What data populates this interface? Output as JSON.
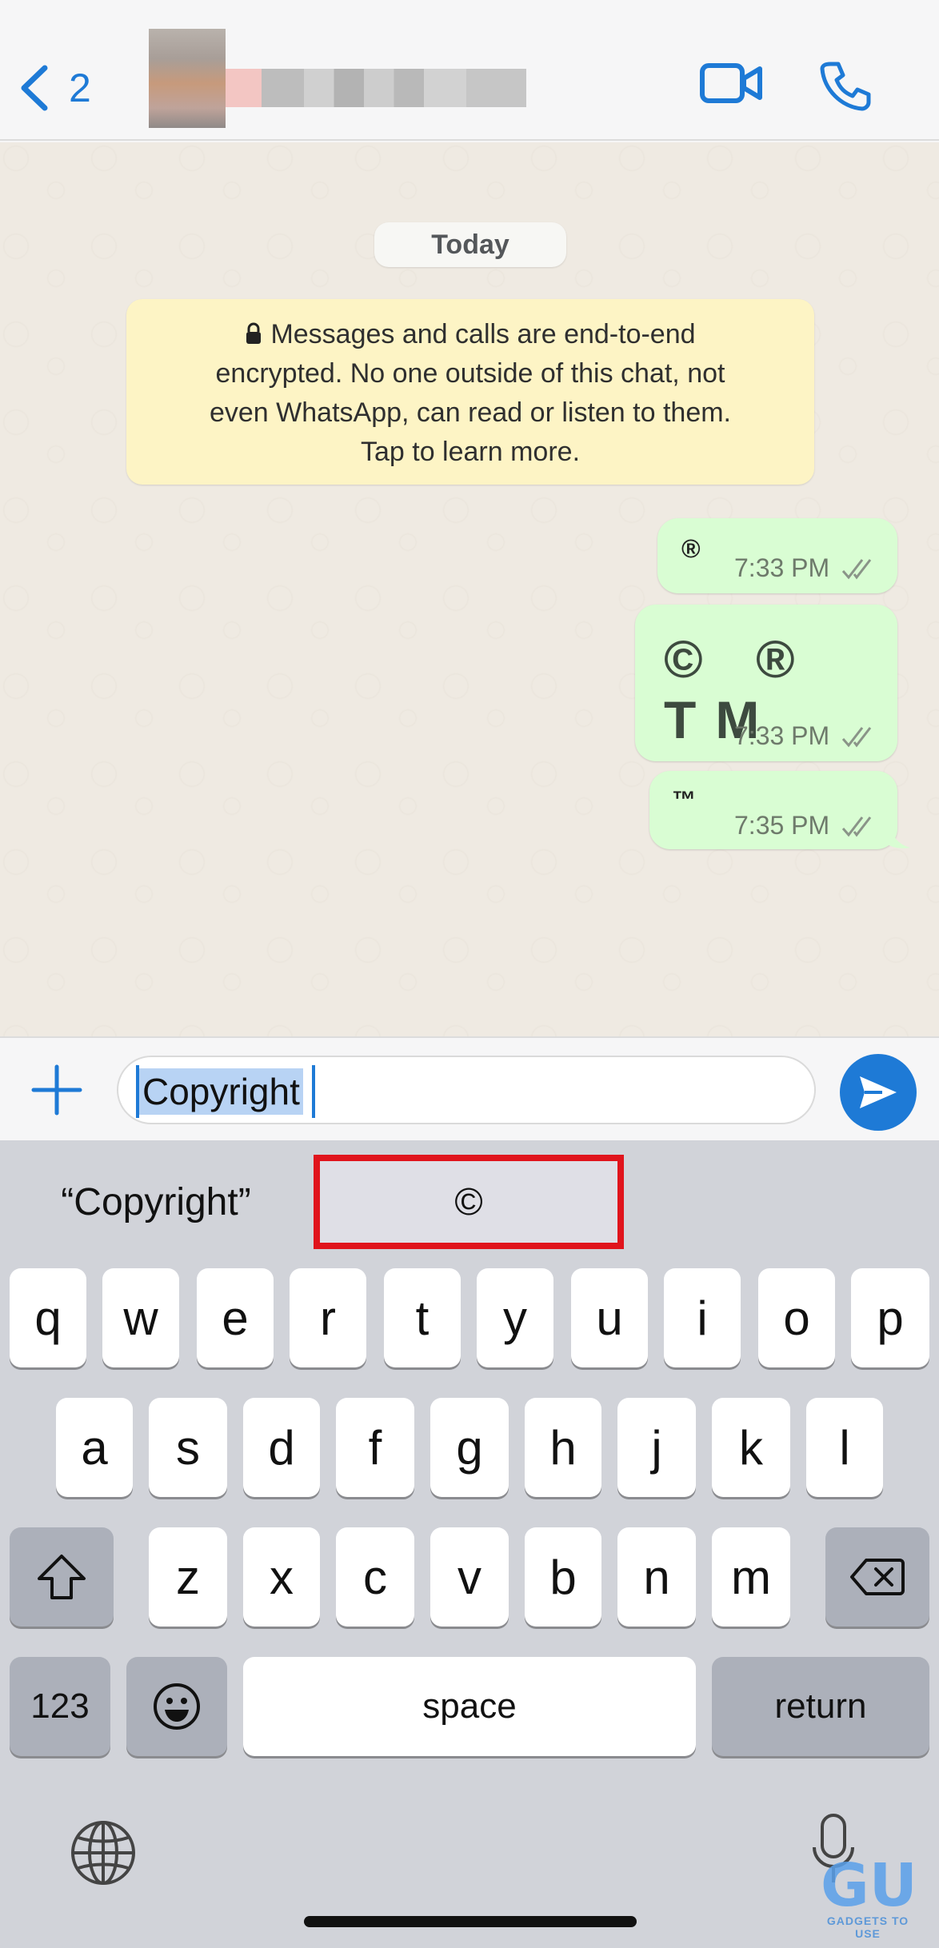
{
  "colors": {
    "accent": "#1e7ad6",
    "outgoing_bubble": "#d9fdd3",
    "notice_bg": "#fdf4c5",
    "highlight_box": "#e0141c"
  },
  "header": {
    "back_count": "2",
    "icons": [
      "chevron-left-icon",
      "video-camera-icon",
      "phone-icon"
    ]
  },
  "chat": {
    "date_label": "Today",
    "notice": {
      "icon": "lock-icon",
      "lines": [
        "Messages and calls are end-to-end",
        "encrypted. No one outside of this chat, not",
        "even WhatsApp, can read or listen to them.",
        "Tap to learn more."
      ]
    },
    "messages": [
      {
        "text": "®",
        "time": "7:33 PM",
        "status": "read-ticks"
      },
      {
        "text": "© ® TM",
        "time": "7:33 PM",
        "status": "read-ticks"
      },
      {
        "text": "™",
        "time": "7:35 PM",
        "status": "read-ticks"
      }
    ]
  },
  "composer": {
    "text": "Copyright",
    "icons": [
      "plus-icon",
      "sticker-icon",
      "send-icon"
    ]
  },
  "keyboard": {
    "suggestions": [
      "“Copyright”",
      "©"
    ],
    "row1": [
      "q",
      "w",
      "e",
      "r",
      "t",
      "y",
      "u",
      "i",
      "o",
      "p"
    ],
    "row2": [
      "a",
      "s",
      "d",
      "f",
      "g",
      "h",
      "j",
      "k",
      "l"
    ],
    "row3": [
      "z",
      "x",
      "c",
      "v",
      "b",
      "n",
      "m"
    ],
    "numbers_label": "123",
    "space_label": "space",
    "return_label": "return",
    "icons": [
      "shift-icon",
      "backspace-icon",
      "emoji-icon",
      "globe-icon",
      "microphone-icon"
    ]
  },
  "watermark": {
    "logo": "GU",
    "text": "GADGETS TO USE"
  }
}
